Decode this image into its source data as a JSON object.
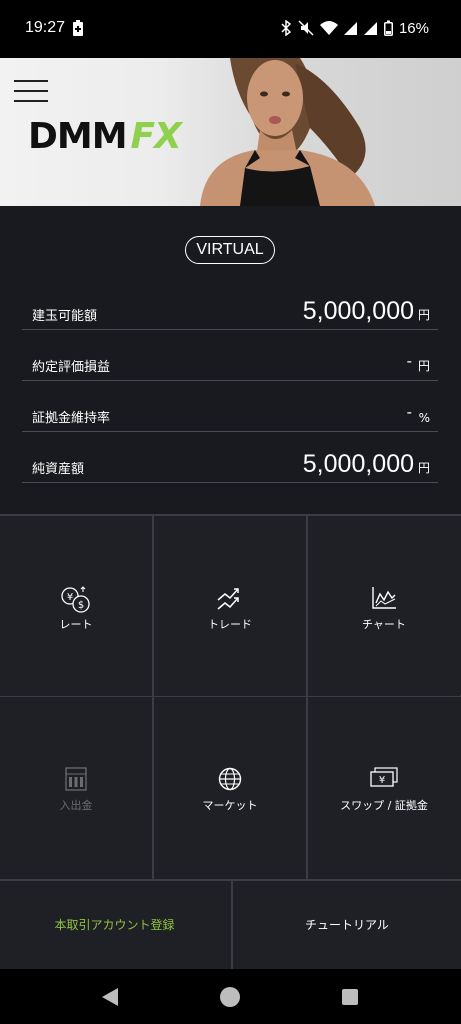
{
  "status_bar": {
    "time": "19:27",
    "battery_percent": "16%",
    "icons": [
      "battery-saver-icon",
      "bluetooth-icon",
      "mute-icon",
      "wifi-icon",
      "signal-icon",
      "signal-icon",
      "battery-icon"
    ]
  },
  "header": {
    "logo_dmm": "DMM",
    "logo_fx": "FX",
    "menu_icon": "hamburger-menu-icon"
  },
  "account": {
    "mode_badge": "VIRTUAL",
    "rows": [
      {
        "label": "建玉可能額",
        "value": "5,000,000",
        "unit": "円"
      },
      {
        "label": "約定評価損益",
        "value": "-",
        "unit": "円"
      },
      {
        "label": "証拠金維持率",
        "value": "-",
        "unit": "%"
      },
      {
        "label": "純資産額",
        "value": "5,000,000",
        "unit": "円"
      }
    ]
  },
  "menu": [
    {
      "label": "レート",
      "icon": "rate-yen-dollar-icon",
      "enabled": true
    },
    {
      "label": "トレード",
      "icon": "trade-trend-icon",
      "enabled": true
    },
    {
      "label": "チャート",
      "icon": "chart-icon",
      "enabled": true
    },
    {
      "label": "入出金",
      "icon": "bank-icon",
      "enabled": false
    },
    {
      "label": "マーケット",
      "icon": "globe-icon",
      "enabled": true
    },
    {
      "label": "スワップ / 証拠金",
      "icon": "yen-bill-icon",
      "enabled": true
    }
  ],
  "bottom_buttons": {
    "register": "本取引アカウント登録",
    "tutorial": "チュートリアル"
  },
  "colors": {
    "accent_green": "#8fd14f",
    "register_green": "#8fc43f",
    "panel_bg": "#191a1f",
    "grid_bg": "#1f2026"
  },
  "nav": [
    "back-icon",
    "home-icon",
    "recents-icon"
  ]
}
